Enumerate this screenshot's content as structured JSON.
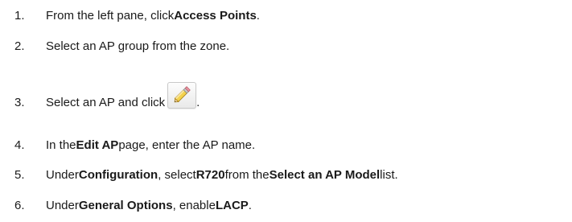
{
  "steps": [
    {
      "number": "1.",
      "parts": [
        "From the left pane, click ",
        "Access Points",
        "."
      ]
    },
    {
      "number": "2.",
      "parts": [
        "Select an AP group from the zone."
      ]
    },
    {
      "number": "3.",
      "parts": [
        "Select an AP and click ",
        "."
      ],
      "icon": "pencil-edit-icon"
    },
    {
      "number": "4.",
      "parts": [
        "In the ",
        "Edit AP",
        " page, enter the AP name."
      ]
    },
    {
      "number": "5.",
      "parts": [
        "Under ",
        "Configuration",
        ", select ",
        "R720",
        " from the ",
        "Select an AP Model",
        " list."
      ]
    },
    {
      "number": "6.",
      "parts": [
        "Under ",
        "General Options",
        ", enable ",
        "LACP",
        "."
      ]
    }
  ]
}
